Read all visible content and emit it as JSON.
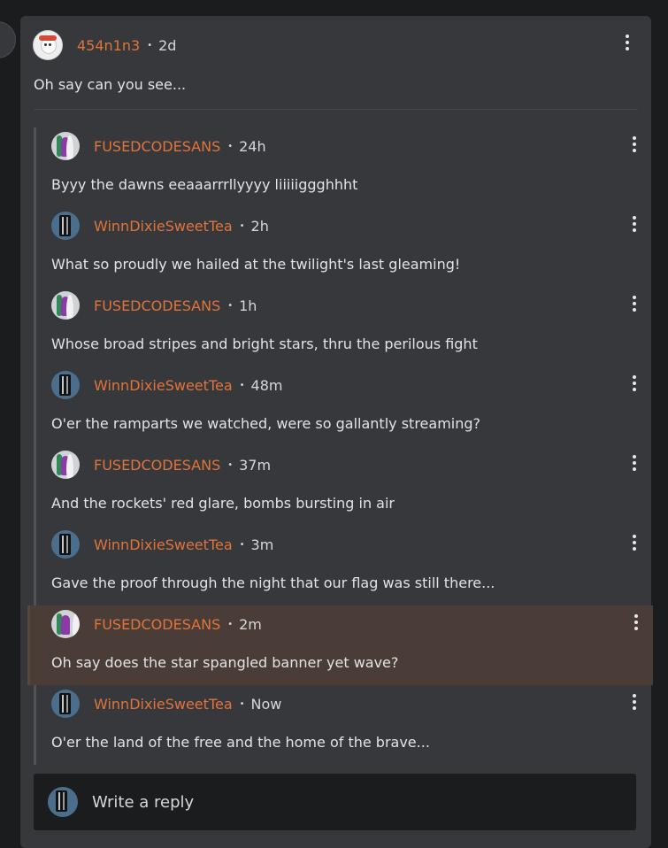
{
  "thread": {
    "author": "454n1n3",
    "time": "2d",
    "body": "Oh say can you see...",
    "separator": "•"
  },
  "replies": [
    {
      "author": "FUSEDCODESANS",
      "time": "24h",
      "body": "Byyy the dawns eeaaarrrllyyyy liiiiiggghhht",
      "avatar": "fused"
    },
    {
      "author": "WinnDixieSweetTea",
      "time": "2h",
      "body": "What so proudly we hailed at the twilight's last gleaming!",
      "avatar": "winn"
    },
    {
      "author": "FUSEDCODESANS",
      "time": "1h",
      "body": "Whose broad stripes and bright stars, thru the perilous fight",
      "avatar": "fused"
    },
    {
      "author": "WinnDixieSweetTea",
      "time": "48m",
      "body": "O'er the ramparts we watched, were so gallantly streaming?",
      "avatar": "winn"
    },
    {
      "author": "FUSEDCODESANS",
      "time": "37m",
      "body": "And the rockets' red glare, bombs bursting in air",
      "avatar": "fused"
    },
    {
      "author": "WinnDixieSweetTea",
      "time": "3m",
      "body": "Gave the proof through the night that our flag was still there...",
      "avatar": "winn"
    },
    {
      "author": "FUSEDCODESANS",
      "time": "2m",
      "body": "Oh say does the star spangled banner yet wave?",
      "avatar": "fused",
      "highlighted": true
    },
    {
      "author": "WinnDixieSweetTea",
      "time": "Now",
      "body": "O'er the land of the free and the home of the brave...",
      "avatar": "winn"
    }
  ],
  "reply_box": {
    "placeholder": "Write a reply"
  },
  "colors": {
    "username": "#e0743a",
    "card": "#36383c",
    "highlight": "#4a3d38",
    "background": "#1b1c1e"
  }
}
